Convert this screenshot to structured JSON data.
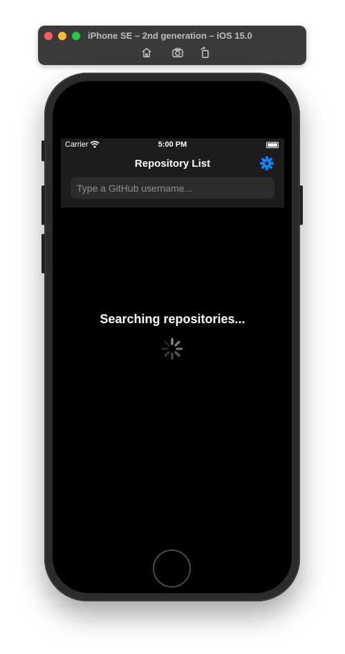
{
  "simulator": {
    "title": "iPhone SE – 2nd generation – iOS 15.0",
    "toolbar_icons": [
      "home-icon",
      "screenshot-icon",
      "rotate-icon"
    ],
    "traffic_colors": [
      "#fe5f57",
      "#febc2e",
      "#28c840"
    ]
  },
  "status_bar": {
    "carrier": "Carrier",
    "time": "5:00 PM",
    "wifi_icon": "wifi-icon",
    "battery_icon": "battery-icon"
  },
  "navbar": {
    "title": "Repository List",
    "settings_icon": "gear-icon",
    "accent_color": "#0a84ff"
  },
  "search": {
    "placeholder": "Type a GitHub username...",
    "value": ""
  },
  "content": {
    "loading_text": "Searching repositories...",
    "spinner_icon": "activity-indicator-icon"
  }
}
